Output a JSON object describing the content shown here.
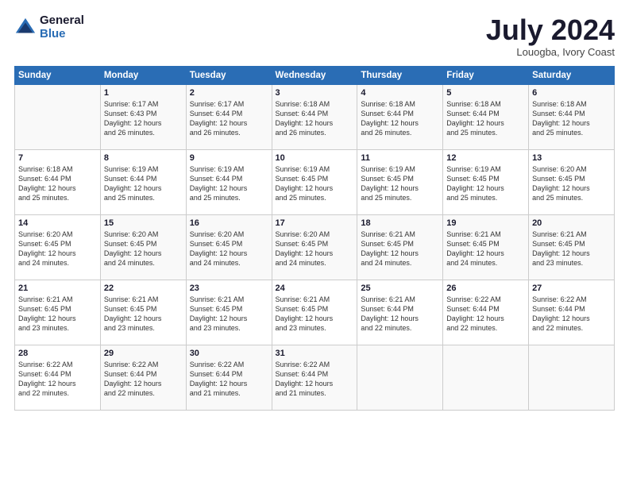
{
  "header": {
    "logo_general": "General",
    "logo_blue": "Blue",
    "title": "July 2024",
    "location": "Louogba, Ivory Coast"
  },
  "days_of_week": [
    "Sunday",
    "Monday",
    "Tuesday",
    "Wednesday",
    "Thursday",
    "Friday",
    "Saturday"
  ],
  "weeks": [
    [
      {
        "day": "",
        "info": ""
      },
      {
        "day": "1",
        "info": "Sunrise: 6:17 AM\nSunset: 6:43 PM\nDaylight: 12 hours\nand 26 minutes."
      },
      {
        "day": "2",
        "info": "Sunrise: 6:17 AM\nSunset: 6:44 PM\nDaylight: 12 hours\nand 26 minutes."
      },
      {
        "day": "3",
        "info": "Sunrise: 6:18 AM\nSunset: 6:44 PM\nDaylight: 12 hours\nand 26 minutes."
      },
      {
        "day": "4",
        "info": "Sunrise: 6:18 AM\nSunset: 6:44 PM\nDaylight: 12 hours\nand 26 minutes."
      },
      {
        "day": "5",
        "info": "Sunrise: 6:18 AM\nSunset: 6:44 PM\nDaylight: 12 hours\nand 25 minutes."
      },
      {
        "day": "6",
        "info": "Sunrise: 6:18 AM\nSunset: 6:44 PM\nDaylight: 12 hours\nand 25 minutes."
      }
    ],
    [
      {
        "day": "7",
        "info": "Sunrise: 6:18 AM\nSunset: 6:44 PM\nDaylight: 12 hours\nand 25 minutes."
      },
      {
        "day": "8",
        "info": "Sunrise: 6:19 AM\nSunset: 6:44 PM\nDaylight: 12 hours\nand 25 minutes."
      },
      {
        "day": "9",
        "info": "Sunrise: 6:19 AM\nSunset: 6:44 PM\nDaylight: 12 hours\nand 25 minutes."
      },
      {
        "day": "10",
        "info": "Sunrise: 6:19 AM\nSunset: 6:45 PM\nDaylight: 12 hours\nand 25 minutes."
      },
      {
        "day": "11",
        "info": "Sunrise: 6:19 AM\nSunset: 6:45 PM\nDaylight: 12 hours\nand 25 minutes."
      },
      {
        "day": "12",
        "info": "Sunrise: 6:19 AM\nSunset: 6:45 PM\nDaylight: 12 hours\nand 25 minutes."
      },
      {
        "day": "13",
        "info": "Sunrise: 6:20 AM\nSunset: 6:45 PM\nDaylight: 12 hours\nand 25 minutes."
      }
    ],
    [
      {
        "day": "14",
        "info": "Sunrise: 6:20 AM\nSunset: 6:45 PM\nDaylight: 12 hours\nand 24 minutes."
      },
      {
        "day": "15",
        "info": "Sunrise: 6:20 AM\nSunset: 6:45 PM\nDaylight: 12 hours\nand 24 minutes."
      },
      {
        "day": "16",
        "info": "Sunrise: 6:20 AM\nSunset: 6:45 PM\nDaylight: 12 hours\nand 24 minutes."
      },
      {
        "day": "17",
        "info": "Sunrise: 6:20 AM\nSunset: 6:45 PM\nDaylight: 12 hours\nand 24 minutes."
      },
      {
        "day": "18",
        "info": "Sunrise: 6:21 AM\nSunset: 6:45 PM\nDaylight: 12 hours\nand 24 minutes."
      },
      {
        "day": "19",
        "info": "Sunrise: 6:21 AM\nSunset: 6:45 PM\nDaylight: 12 hours\nand 24 minutes."
      },
      {
        "day": "20",
        "info": "Sunrise: 6:21 AM\nSunset: 6:45 PM\nDaylight: 12 hours\nand 23 minutes."
      }
    ],
    [
      {
        "day": "21",
        "info": "Sunrise: 6:21 AM\nSunset: 6:45 PM\nDaylight: 12 hours\nand 23 minutes."
      },
      {
        "day": "22",
        "info": "Sunrise: 6:21 AM\nSunset: 6:45 PM\nDaylight: 12 hours\nand 23 minutes."
      },
      {
        "day": "23",
        "info": "Sunrise: 6:21 AM\nSunset: 6:45 PM\nDaylight: 12 hours\nand 23 minutes."
      },
      {
        "day": "24",
        "info": "Sunrise: 6:21 AM\nSunset: 6:45 PM\nDaylight: 12 hours\nand 23 minutes."
      },
      {
        "day": "25",
        "info": "Sunrise: 6:21 AM\nSunset: 6:44 PM\nDaylight: 12 hours\nand 22 minutes."
      },
      {
        "day": "26",
        "info": "Sunrise: 6:22 AM\nSunset: 6:44 PM\nDaylight: 12 hours\nand 22 minutes."
      },
      {
        "day": "27",
        "info": "Sunrise: 6:22 AM\nSunset: 6:44 PM\nDaylight: 12 hours\nand 22 minutes."
      }
    ],
    [
      {
        "day": "28",
        "info": "Sunrise: 6:22 AM\nSunset: 6:44 PM\nDaylight: 12 hours\nand 22 minutes."
      },
      {
        "day": "29",
        "info": "Sunrise: 6:22 AM\nSunset: 6:44 PM\nDaylight: 12 hours\nand 22 minutes."
      },
      {
        "day": "30",
        "info": "Sunrise: 6:22 AM\nSunset: 6:44 PM\nDaylight: 12 hours\nand 21 minutes."
      },
      {
        "day": "31",
        "info": "Sunrise: 6:22 AM\nSunset: 6:44 PM\nDaylight: 12 hours\nand 21 minutes."
      },
      {
        "day": "",
        "info": ""
      },
      {
        "day": "",
        "info": ""
      },
      {
        "day": "",
        "info": ""
      }
    ]
  ]
}
